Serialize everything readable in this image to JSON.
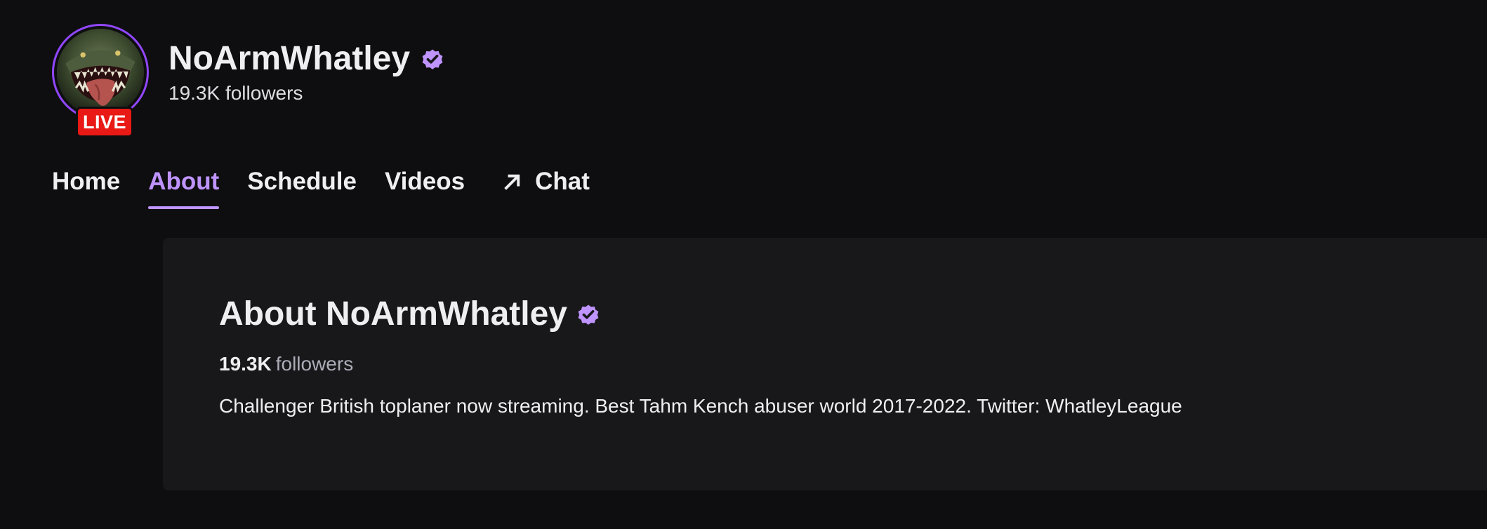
{
  "channel": {
    "name": "NoArmWhatley",
    "followers_text": "19.3K followers",
    "live_label": "LIVE",
    "verified": true,
    "avatar_icon": "tahm-kench-avatar"
  },
  "nav": {
    "tabs": [
      {
        "label": "Home",
        "active": false
      },
      {
        "label": "About",
        "active": true
      },
      {
        "label": "Schedule",
        "active": false
      },
      {
        "label": "Videos",
        "active": false
      },
      {
        "label": "Chat",
        "active": false,
        "icon": "external-arrow-icon"
      }
    ]
  },
  "about": {
    "title": "About NoArmWhatley",
    "followers_count": "19.3K",
    "followers_label": "followers",
    "description": "Challenger British toplaner now streaming. Best Tahm Kench abuser world 2017-2022. Twitter: WhatleyLeague"
  },
  "colors": {
    "background": "#0e0e10",
    "panel": "#18181b",
    "accent": "#bf94ff",
    "brand_purple": "#9147ff",
    "live_red": "#e91916"
  }
}
